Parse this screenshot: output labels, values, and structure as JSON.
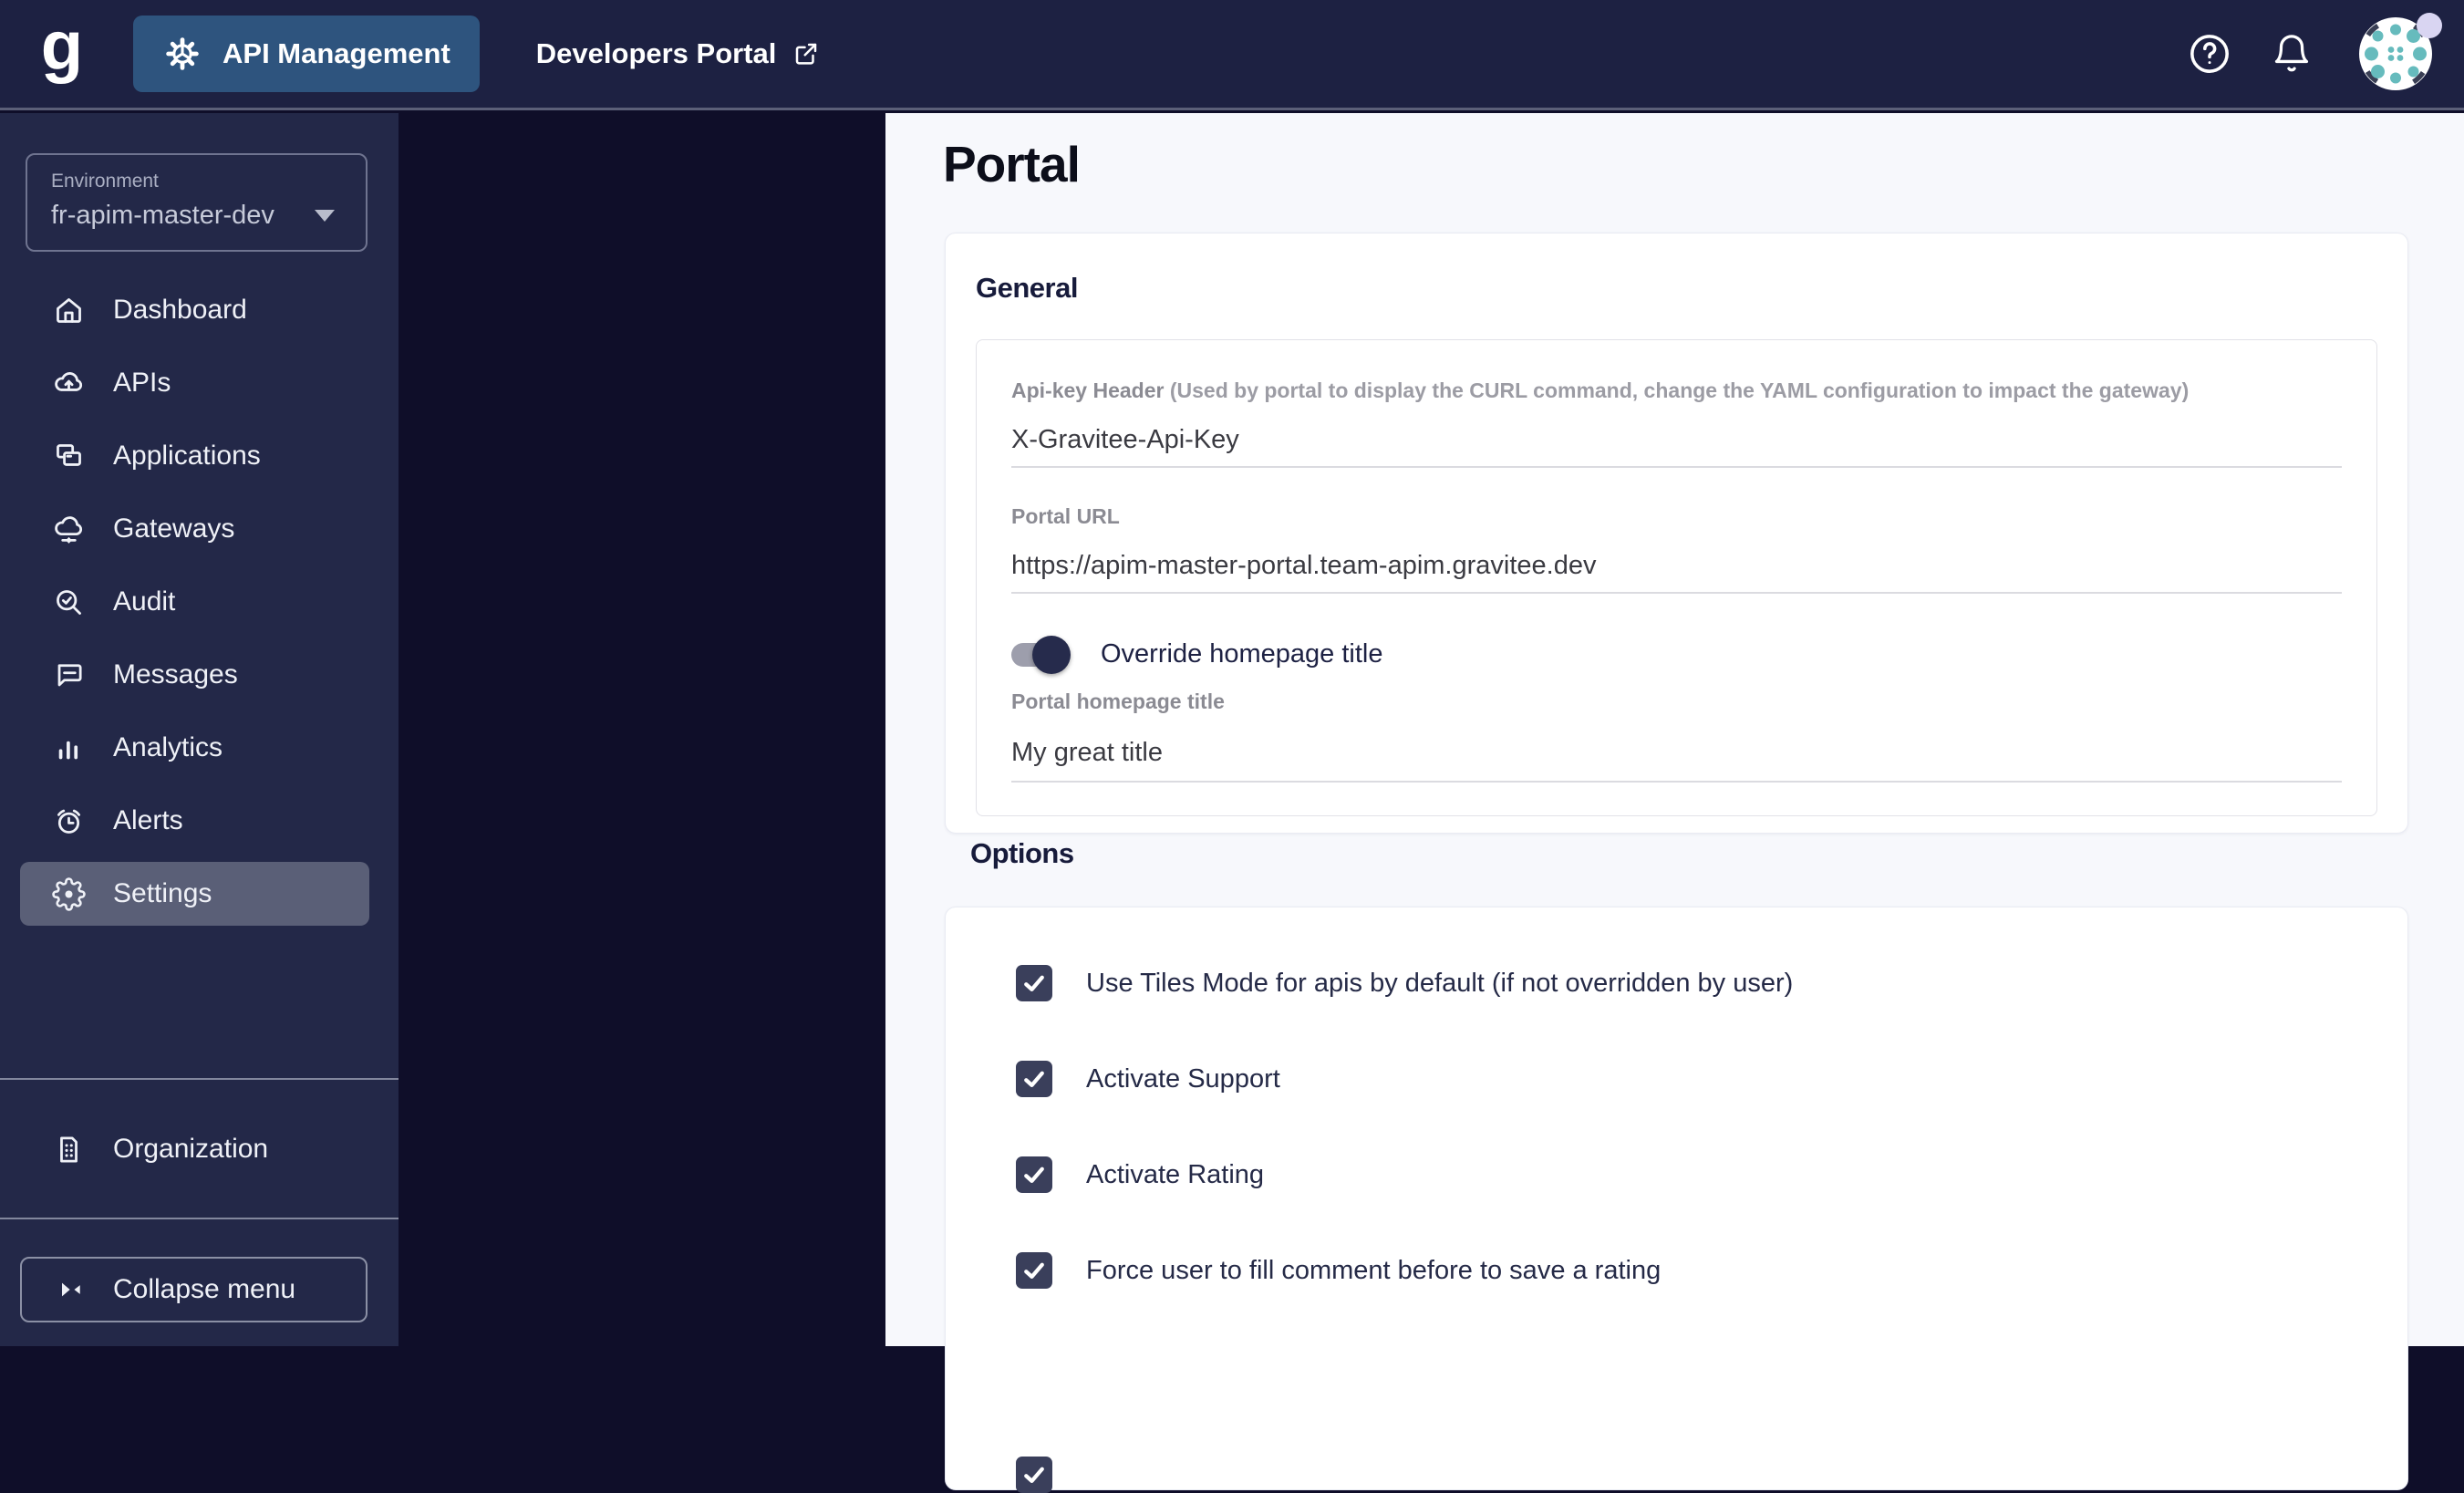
{
  "topbar": {
    "logo_letter": "g",
    "api_management_label": "API Management",
    "developers_portal_label": "Developers Portal"
  },
  "sidebar": {
    "environment": {
      "label": "Environment",
      "value": "fr-apim-master-dev"
    },
    "items": [
      {
        "label": "Dashboard",
        "icon": "home-icon"
      },
      {
        "label": "APIs",
        "icon": "cloud-upload-icon"
      },
      {
        "label": "Applications",
        "icon": "applications-icon"
      },
      {
        "label": "Gateways",
        "icon": "cloud-gateway-icon"
      },
      {
        "label": "Audit",
        "icon": "search-check-icon"
      },
      {
        "label": "Messages",
        "icon": "message-icon"
      },
      {
        "label": "Analytics",
        "icon": "bar-chart-icon"
      },
      {
        "label": "Alerts",
        "icon": "alarm-icon"
      },
      {
        "label": "Settings",
        "icon": "gear-icon",
        "selected": true
      }
    ],
    "organization_label": "Organization",
    "collapse_label": "Collapse menu"
  },
  "main": {
    "title": "Portal",
    "general": {
      "heading": "General",
      "apikey_field": {
        "label": "Api-key Header",
        "note": "(Used by portal to display the CURL command, change the YAML configuration to impact the gateway)",
        "value": "X-Gravitee-Api-Key"
      },
      "portal_url_field": {
        "label": "Portal URL",
        "value": "https://apim-master-portal.team-apim.gravitee.dev"
      },
      "override_toggle": {
        "label": "Override homepage title",
        "state": "on"
      },
      "homepage_title_field": {
        "label": "Portal homepage title",
        "value": "My great title"
      }
    },
    "options": {
      "heading": "Options",
      "checkboxes": [
        {
          "label": "Use Tiles Mode for apis by default (if not overridden by user)",
          "checked": true
        },
        {
          "label": "Activate Support",
          "checked": true
        },
        {
          "label": "Activate Rating",
          "checked": true
        },
        {
          "label": "Force user to fill comment before to save a rating",
          "checked": true
        },
        {
          "label": "",
          "checked": true
        }
      ]
    }
  },
  "colors": {
    "topbar_bg": "#1d2142",
    "sidebar_bg": "#232848",
    "accent_blue": "#2e547e",
    "selected_item": "#5a5f77",
    "checkbox": "#3a3f5b",
    "avatar_teal": "#66bbbd",
    "badge_lavender": "#d9d5f2",
    "main_bg": "#f7f8fc"
  }
}
